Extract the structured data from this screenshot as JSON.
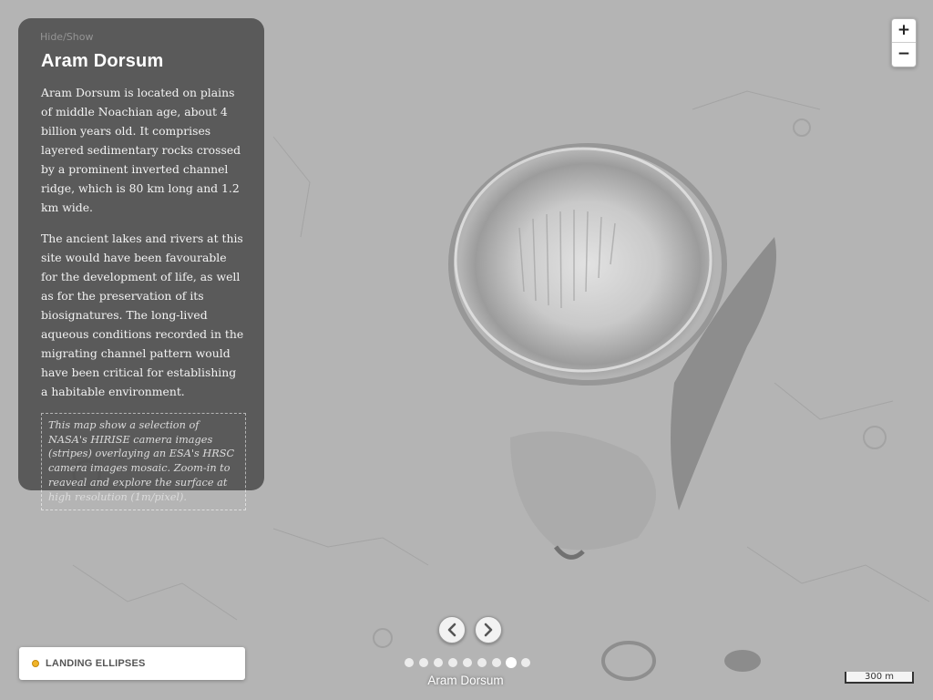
{
  "panel": {
    "toggle_label": "Hide/Show",
    "title": "Aram Dorsum",
    "paragraphs": [
      "Aram Dorsum is located on plains of middle Noachian age, about 4 billion years old. It comprises layered sedimentary rocks crossed by a prominent inverted channel ridge, which is 80 km long and 1.2 km wide.",
      "The ancient lakes and rivers at this site would have been favourable for the development of life, as well as for the preservation of its biosignatures. The long-lived aqueous conditions recorded in the migrating channel pattern would have been critical for establishing a habitable environment."
    ],
    "note": "This map show a selection of NASA's HIRISE camera images (stripes) overlaying an ESA's HRSC camera images mosaic. Zoom-in to reaveal and explore the surface at high resolution (1m/pixel)."
  },
  "zoom": {
    "in_label": "+",
    "out_label": "−"
  },
  "navigation": {
    "prev_icon": "chevron-left-icon",
    "next_icon": "chevron-right-icon",
    "slide_count": 9,
    "active_index": 7,
    "current_label": "Aram Dorsum"
  },
  "legend": {
    "label": "LANDING ELLIPSES",
    "dot_color": "#f0b429"
  },
  "scale": {
    "label": "300 m"
  }
}
